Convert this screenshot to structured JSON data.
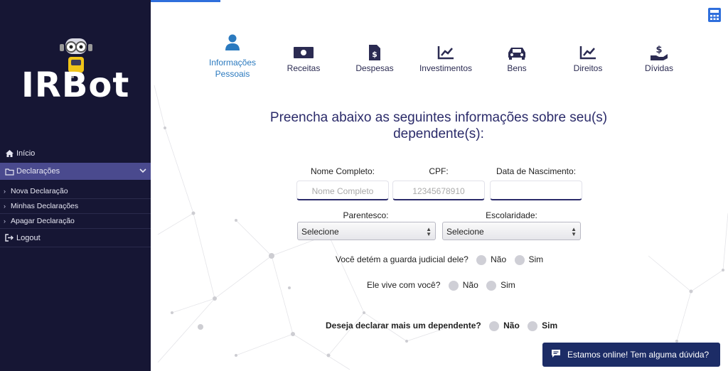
{
  "brand": {
    "logo_text": "IRBot"
  },
  "sidebar": {
    "items": [
      {
        "label": "Início",
        "icon": "home-icon"
      },
      {
        "label": "Declarações",
        "icon": "folder-icon"
      }
    ],
    "submenu": [
      {
        "label": "Nova Declaração"
      },
      {
        "label": "Minhas Declarações"
      },
      {
        "label": "Apagar Declaração"
      }
    ],
    "logout": {
      "label": "Logout",
      "icon": "logout-icon"
    }
  },
  "steps": [
    {
      "label_line1": "Informações",
      "label_line2": "Pessoais",
      "icon": "user-icon",
      "active": true
    },
    {
      "label_line1": "Receitas",
      "label_line2": "",
      "icon": "money-icon"
    },
    {
      "label_line1": "Despesas",
      "label_line2": "",
      "icon": "invoice-icon"
    },
    {
      "label_line1": "Investimentos",
      "label_line2": "",
      "icon": "chart-icon"
    },
    {
      "label_line1": "Bens",
      "label_line2": "",
      "icon": "car-icon"
    },
    {
      "label_line1": "Direitos",
      "label_line2": "",
      "icon": "chart-icon"
    },
    {
      "label_line1": "Dívidas",
      "label_line2": "",
      "icon": "hand-dollar-icon"
    }
  ],
  "form": {
    "heading_line1": "Preencha abaixo as seguintes informações sobre seu(s)",
    "heading_line2": "dependente(s):",
    "nome": {
      "label": "Nome Completo:",
      "placeholder": "Nome Completo"
    },
    "cpf": {
      "label": "CPF:",
      "placeholder": "12345678910"
    },
    "nascimento": {
      "label": "Data de Nascimento:",
      "placeholder": ""
    },
    "parentesco": {
      "label": "Parentesco:",
      "value": "Selecione"
    },
    "escolaridade": {
      "label": "Escolaridade:",
      "value": "Selecione"
    },
    "guarda": {
      "question": "Você detém a guarda judicial dele?",
      "no": "Não",
      "yes": "Sim"
    },
    "vive": {
      "question": "Ele vive com você?",
      "no": "Não",
      "yes": "Sim"
    },
    "mais": {
      "question": "Deseja declarar mais um dependente?",
      "no": "Não",
      "yes": "Sim"
    }
  },
  "chat": {
    "label": "Estamos online! Tem alguma dúvida?",
    "icon": "chat-icon"
  },
  "colors": {
    "sidebar": "#161634",
    "active_nav": "#4a4a8e",
    "accent": "#2b7abf",
    "primary": "#2b2b6a",
    "chat": "#1c2c66"
  }
}
